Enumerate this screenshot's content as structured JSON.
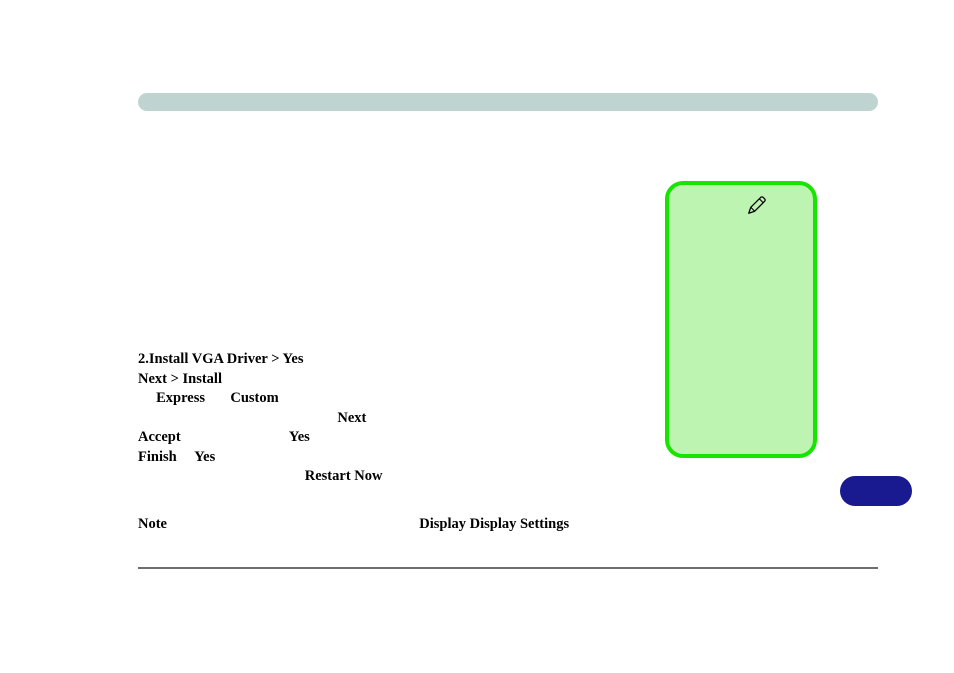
{
  "content": {
    "line1": "2.Install VGA Driver > Yes",
    "line2": "Next > Install",
    "line3": "     Express       Custom",
    "line4": "                                                       Next",
    "line5": "Accept                              Yes",
    "line6": "Finish     Yes",
    "line7": "                                              Restart Now"
  },
  "note": {
    "label": "Note",
    "text": "Display Display Settings"
  },
  "icons": {
    "pen": "pen-icon"
  }
}
